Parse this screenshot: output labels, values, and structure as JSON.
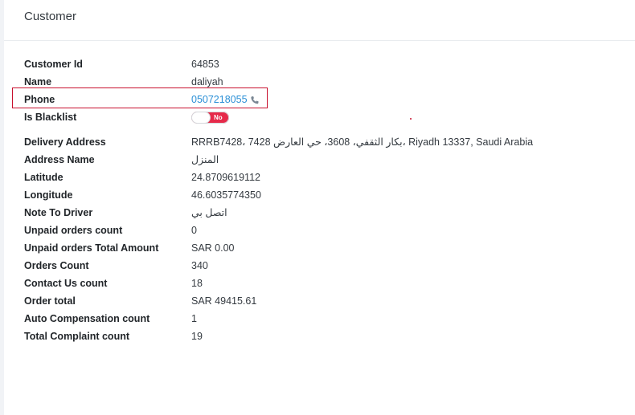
{
  "card": {
    "title": "Customer"
  },
  "fields": {
    "customer_id": {
      "label": "Customer Id",
      "value": "64853"
    },
    "name": {
      "label": "Name",
      "value": "daliyah"
    },
    "phone": {
      "label": "Phone",
      "value": "0507218055",
      "icon": "phone-icon"
    },
    "is_blacklist": {
      "label": "Is Blacklist",
      "toggle_text": "No",
      "state": "off"
    },
    "delivery_address": {
      "label": "Delivery Address",
      "value": "RRRB7428، 7428 بكار الثقفي، 3608، حي العارض، Riyadh 13337, Saudi Arabia"
    },
    "address_name": {
      "label": "Address Name",
      "value": "المنزل"
    },
    "latitude": {
      "label": "Latitude",
      "value": "24.8709619112"
    },
    "longitude": {
      "label": "Longitude",
      "value": "46.6035774350"
    },
    "note_to_driver": {
      "label": "Note To Driver",
      "value": "اتصل بي"
    },
    "unpaid_orders_count": {
      "label": "Unpaid orders count",
      "value": "0"
    },
    "unpaid_orders_total_amount": {
      "label": "Unpaid orders Total Amount",
      "value": "SAR 0.00"
    },
    "orders_count": {
      "label": "Orders Count",
      "value": "340"
    },
    "contact_us_count": {
      "label": "Contact Us count",
      "value": "18"
    },
    "order_total": {
      "label": "Order total",
      "value": "SAR 49415.61"
    },
    "auto_compensation_count": {
      "label": "Auto Compensation count",
      "value": "1"
    },
    "total_complaint_count": {
      "label": "Total Complaint count",
      "value": "19"
    }
  },
  "colors": {
    "link": "#2a8fd6",
    "address": "#e0202a",
    "toggle_on": "#e62a4a",
    "highlight": "#c8102e"
  }
}
